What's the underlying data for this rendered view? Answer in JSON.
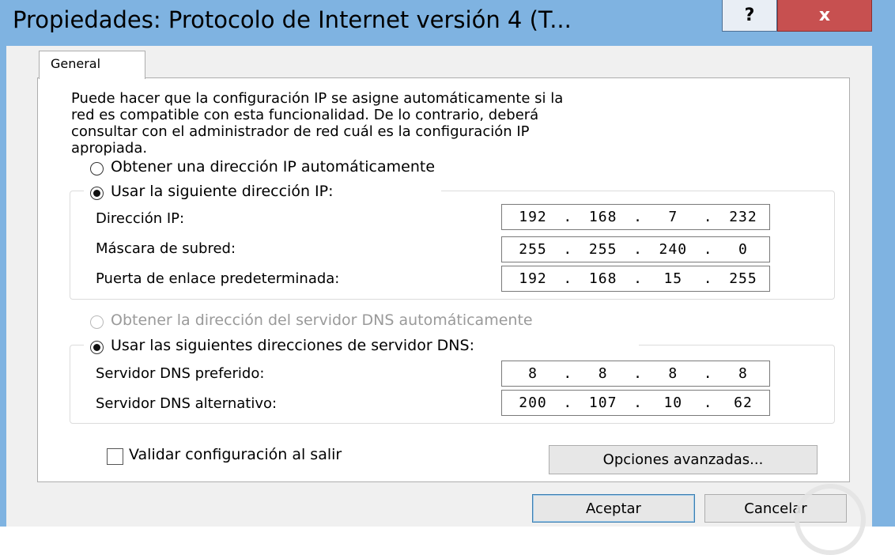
{
  "window": {
    "title": "Propiedades: Protocolo de Internet versión 4 (T...",
    "help_label": "?",
    "close_label": "x"
  },
  "tabs": [
    {
      "label": "General"
    }
  ],
  "description": "Puede hacer que la configuración IP se asigne automáticamente si la\nred es compatible con esta funcionalidad. De lo contrario, deberá\nconsultar con el administrador de red cuál es la configuración IP\napropiada.",
  "ip": {
    "auto_label": "Obtener una dirección IP automáticamente",
    "auto_selected": false,
    "manual_label": "Usar la siguiente dirección IP:",
    "manual_selected": true,
    "address_label": "Dirección IP:",
    "address": [
      "192",
      "168",
      "7",
      "232"
    ],
    "mask_label": "Máscara de subred:",
    "mask": [
      "255",
      "255",
      "240",
      "0"
    ],
    "gateway_label": "Puerta de enlace predeterminada:",
    "gateway": [
      "192",
      "168",
      "15",
      "255"
    ]
  },
  "dns": {
    "auto_label": "Obtener la dirección del servidor DNS automáticamente",
    "auto_enabled": false,
    "manual_label": "Usar las siguientes direcciones de servidor DNS:",
    "manual_selected": true,
    "preferred_label": "Servidor DNS preferido:",
    "preferred": [
      "8",
      "8",
      "8",
      "8"
    ],
    "alternate_label": "Servidor DNS alternativo:",
    "alternate": [
      "200",
      "107",
      "10",
      "62"
    ]
  },
  "validate": {
    "label": "Validar configuración al salir",
    "checked": false
  },
  "buttons": {
    "advanced": "Opciones avanzadas...",
    "ok": "Aceptar",
    "cancel": "Cancelar"
  }
}
